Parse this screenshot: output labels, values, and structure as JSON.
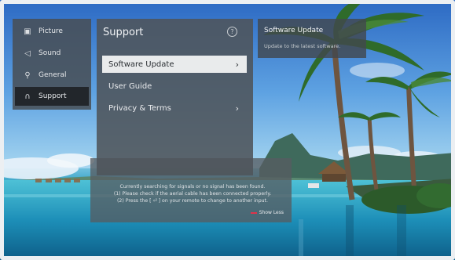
{
  "left_menu": {
    "items": [
      {
        "label": "Picture",
        "icon": "picture-icon",
        "active": false
      },
      {
        "label": "Sound",
        "icon": "speaker-icon",
        "active": false
      },
      {
        "label": "General",
        "icon": "wrench-icon",
        "active": false
      },
      {
        "label": "Support",
        "icon": "headset-icon",
        "active": true
      }
    ]
  },
  "support_panel": {
    "title": "Support",
    "help_icon_glyph": "?",
    "options": [
      {
        "label": "Software Update",
        "selected": true,
        "has_arrow": true,
        "arrow": "›"
      },
      {
        "label": "User Guide",
        "selected": false,
        "has_arrow": false
      },
      {
        "label": "Privacy & Terms",
        "selected": false,
        "has_arrow": true,
        "arrow": "›"
      }
    ]
  },
  "info_panel": {
    "title": "Software Update",
    "description": "Update to the latest software."
  },
  "no_signal_message": {
    "lines": [
      "Currently searching for signals or no signal has been found.",
      "(1) Please check if the aerial cable has been connected properly.",
      "(2) Press the [ ⏎ ] on your remote to change to another input."
    ],
    "show_more": "Show Less"
  },
  "colors": {
    "accent": "#e0324a",
    "panel": "#4e545a",
    "selected_bg": "#e9ebec"
  }
}
